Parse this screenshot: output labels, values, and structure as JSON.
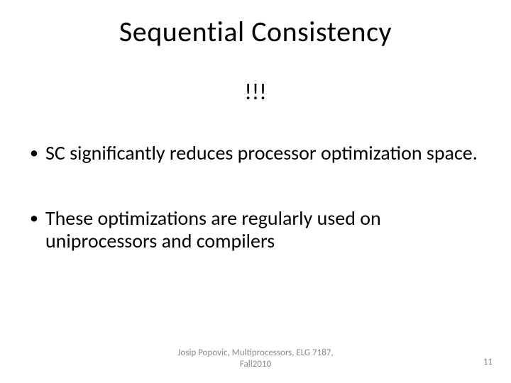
{
  "slide": {
    "title": "Sequential Consistency",
    "emphasis": "!!!",
    "bullets": [
      "SC significantly reduces processor optimization space.",
      "These optimizations are regularly used on uniprocessors and compilers"
    ],
    "footer_line1": "Josip Popovic, Multiprocessors, ELG 7187,",
    "footer_line2": "Fall2010",
    "page_number": "11"
  }
}
